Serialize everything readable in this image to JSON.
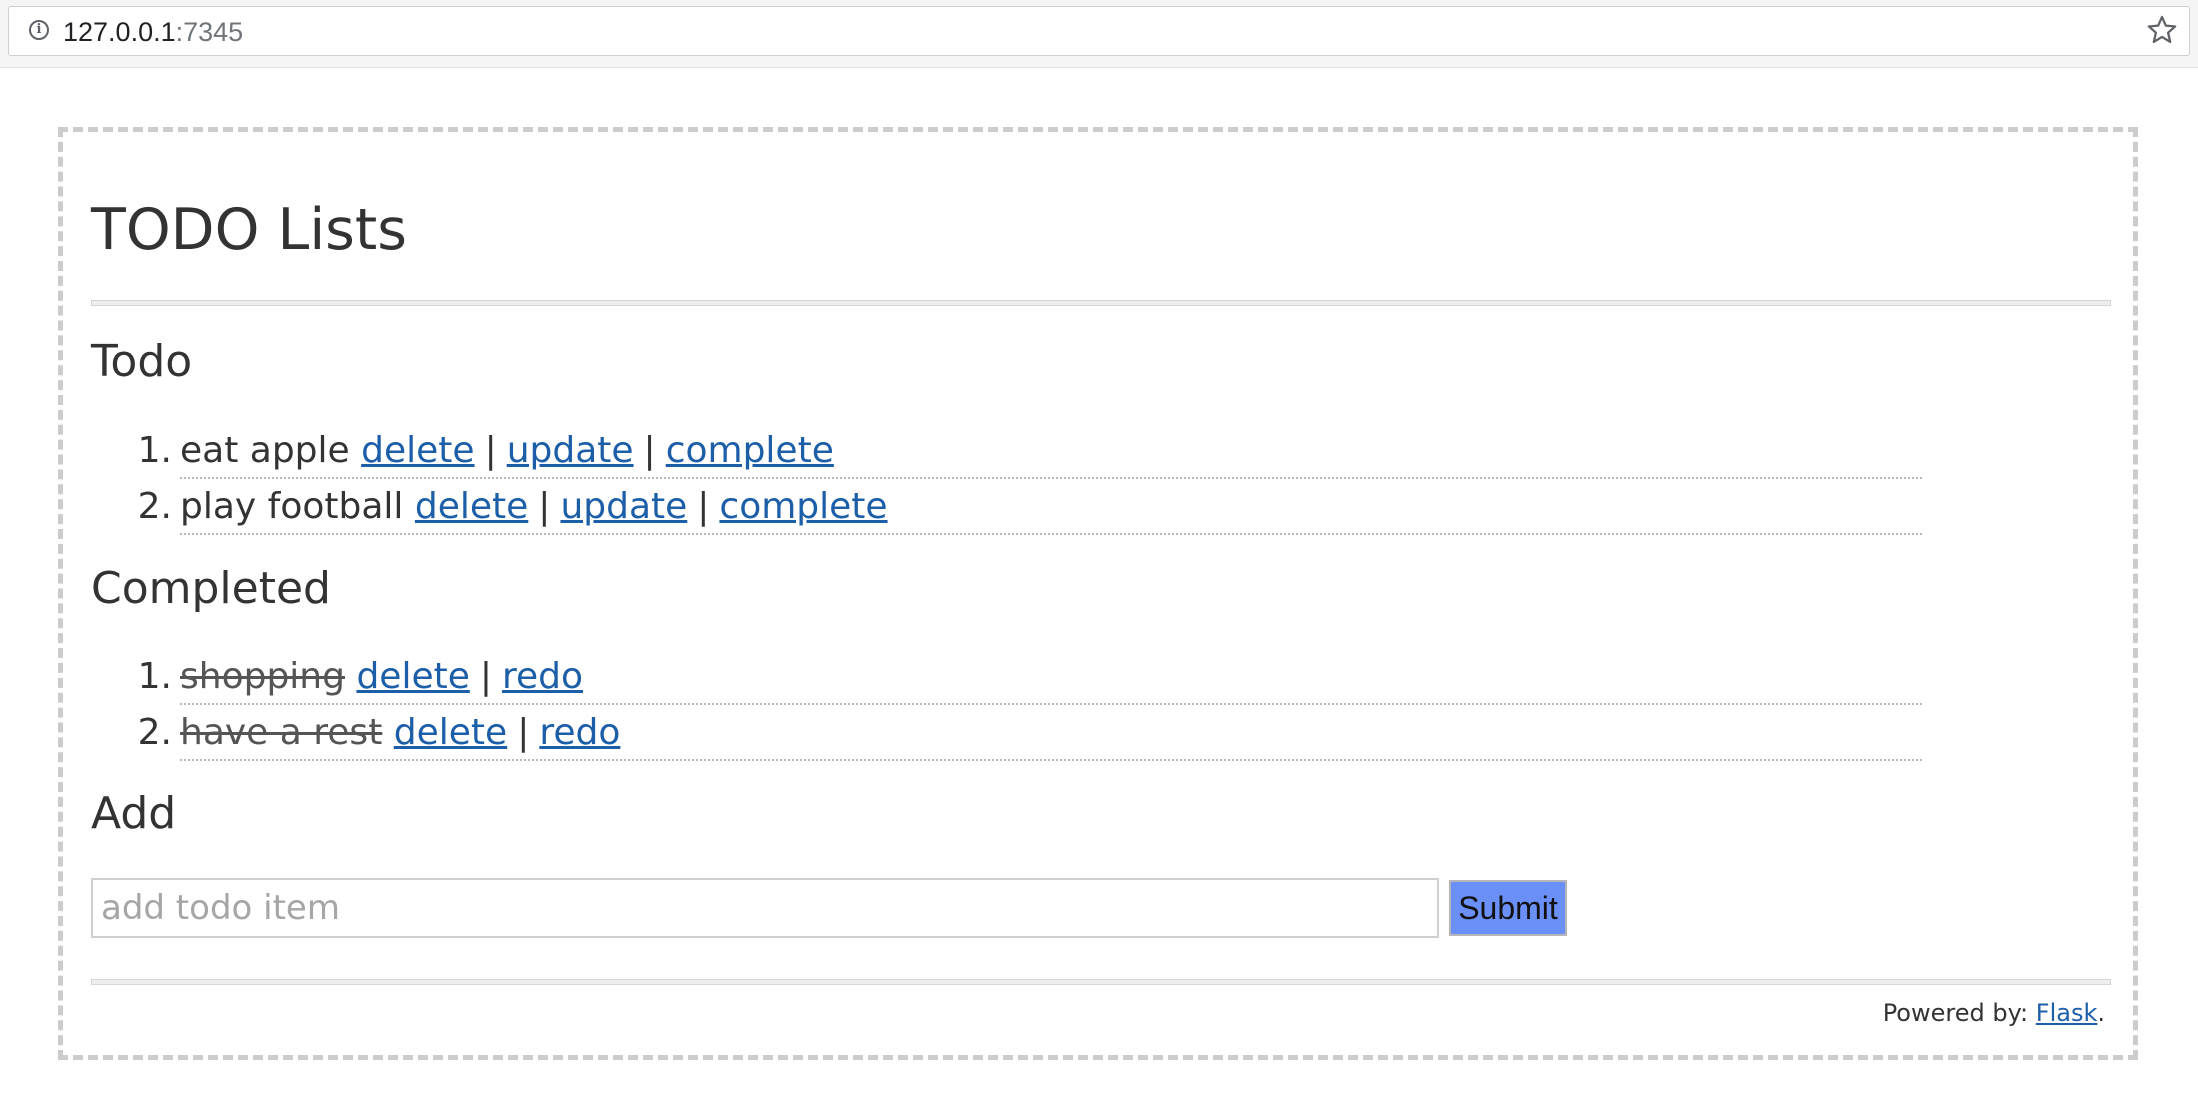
{
  "browser": {
    "url_host": "127.0.0.1",
    "url_port": ":7345",
    "info_icon": "i"
  },
  "page": {
    "title": "TODO Lists"
  },
  "todo": {
    "heading": "Todo",
    "items": [
      {
        "number": "1.",
        "text": "eat apple",
        "delete_label": "delete",
        "update_label": "update",
        "complete_label": "complete"
      },
      {
        "number": "2.",
        "text": "play football",
        "delete_label": "delete",
        "update_label": "update",
        "complete_label": "complete"
      }
    ]
  },
  "completed": {
    "heading": "Completed",
    "items": [
      {
        "number": "1.",
        "text": "shopping",
        "delete_label": "delete",
        "redo_label": "redo"
      },
      {
        "number": "2.",
        "text": "have a rest",
        "delete_label": "delete",
        "redo_label": "redo"
      }
    ]
  },
  "separator": "|",
  "add": {
    "heading": "Add",
    "placeholder": "add todo item",
    "value": "",
    "submit_label": "Submit"
  },
  "footer": {
    "prefix": "Powered by: ",
    "link_label": "Flask",
    "suffix": "."
  },
  "colors": {
    "link": "#1c5fa8",
    "submit_bg": "#6a8ff7",
    "border_dashed": "#cccccc"
  }
}
